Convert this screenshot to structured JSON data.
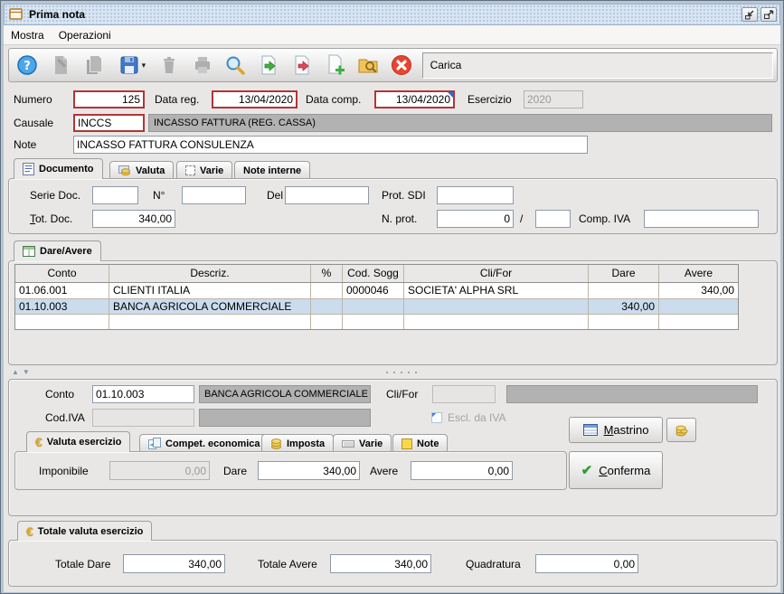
{
  "window": {
    "title": "Prima nota",
    "controls": [
      "iconify",
      "maximize"
    ]
  },
  "menu": {
    "items": [
      "Mostra",
      "Operazioni"
    ]
  },
  "toolbar": {
    "status": "Carica",
    "icons": [
      "help",
      "edit",
      "duplicate",
      "save",
      "delete",
      "print",
      "search",
      "import-document",
      "export-document",
      "new-document",
      "search-archive",
      "cancel"
    ]
  },
  "header": {
    "numero_label": "Numero",
    "numero": "125",
    "data_reg_label": "Data reg.",
    "data_reg": "13/04/2020",
    "data_comp_label": "Data comp.",
    "data_comp": "13/04/2020",
    "esercizio_label": "Esercizio",
    "esercizio": "2020",
    "causale_label": "Causale",
    "causale": "INCCS",
    "causale_desc": "INCASSO FATTURA (REG. CASSA)",
    "note_label": "Note",
    "note": "INCASSO FATTURA CONSULENZA"
  },
  "documento_tabs": {
    "tabs": [
      "Documento",
      "Valuta",
      "Varie",
      "Note interne"
    ],
    "active": "Documento"
  },
  "documento": {
    "serie_doc_label": "Serie Doc.",
    "serie_doc": "",
    "n_label": "N°",
    "n": "",
    "del_label": "Del",
    "del": "",
    "prot_sdi_label": "Prot. SDI",
    "prot_sdi": "",
    "tot_doc_label": "Tot. Doc.",
    "tot_doc": "340,00",
    "n_prot_label": "N. prot.",
    "n_prot": "0",
    "slash": "/",
    "n_prot2": "",
    "comp_iva_label": "Comp. IVA",
    "comp_iva": ""
  },
  "grid": {
    "tab_label": "Dare/Avere",
    "columns": [
      "Conto",
      "Descriz.",
      "%",
      "Cod. Sogg",
      "Cli/For",
      "Dare",
      "Avere"
    ],
    "rows": [
      {
        "conto": "01.06.001",
        "descr": "CLIENTI ITALIA",
        "pct": "",
        "cod_sogg": "0000046",
        "cli_for": "SOCIETA' ALPHA SRL",
        "dare": "",
        "avere": "340,00"
      },
      {
        "conto": "01.10.003",
        "descr": "BANCA AGRICOLA COMMERCIALE",
        "pct": "",
        "cod_sogg": "",
        "cli_for": "",
        "dare": "340,00",
        "avere": ""
      },
      {
        "conto": "",
        "descr": "",
        "pct": "",
        "cod_sogg": "",
        "cli_for": "",
        "dare": "",
        "avere": ""
      }
    ],
    "selected_row_index": 1
  },
  "detail": {
    "conto_label": "Conto",
    "conto": "01.10.003",
    "conto_desc": "BANCA AGRICOLA COMMERCIALE",
    "cli_for_label": "Cli/For",
    "cli_for": "",
    "cli_for_desc": "",
    "cod_iva_label": "Cod.IVA",
    "cod_iva": "",
    "cod_iva_desc": "",
    "escl_iva_label": "Escl. da IVA",
    "tabs": [
      "Valuta esercizio",
      "Compet. economica",
      "Imposta",
      "Varie",
      "Note"
    ],
    "active_tab": "Valuta esercizio",
    "imponibile_label": "Imponibile",
    "imponibile": "0,00",
    "dare_label": "Dare",
    "dare": "340,00",
    "avere_label": "Avere",
    "avere": "0,00",
    "mastrino_label": "Mastrino",
    "conferma_label": "Conferma"
  },
  "totals": {
    "tab_label": "Totale valuta esercizio",
    "totale_dare_label": "Totale Dare",
    "totale_dare": "340,00",
    "totale_avere_label": "Totale Avere",
    "totale_avere": "340,00",
    "quadratura_label": "Quadratura",
    "quadratura": "0,00"
  },
  "colors": {
    "mandatory_border": "#b23535",
    "selected_row": "#cbdcec",
    "disabled_field": "#b2b2b2",
    "titlebar": "#d9e5f2"
  }
}
